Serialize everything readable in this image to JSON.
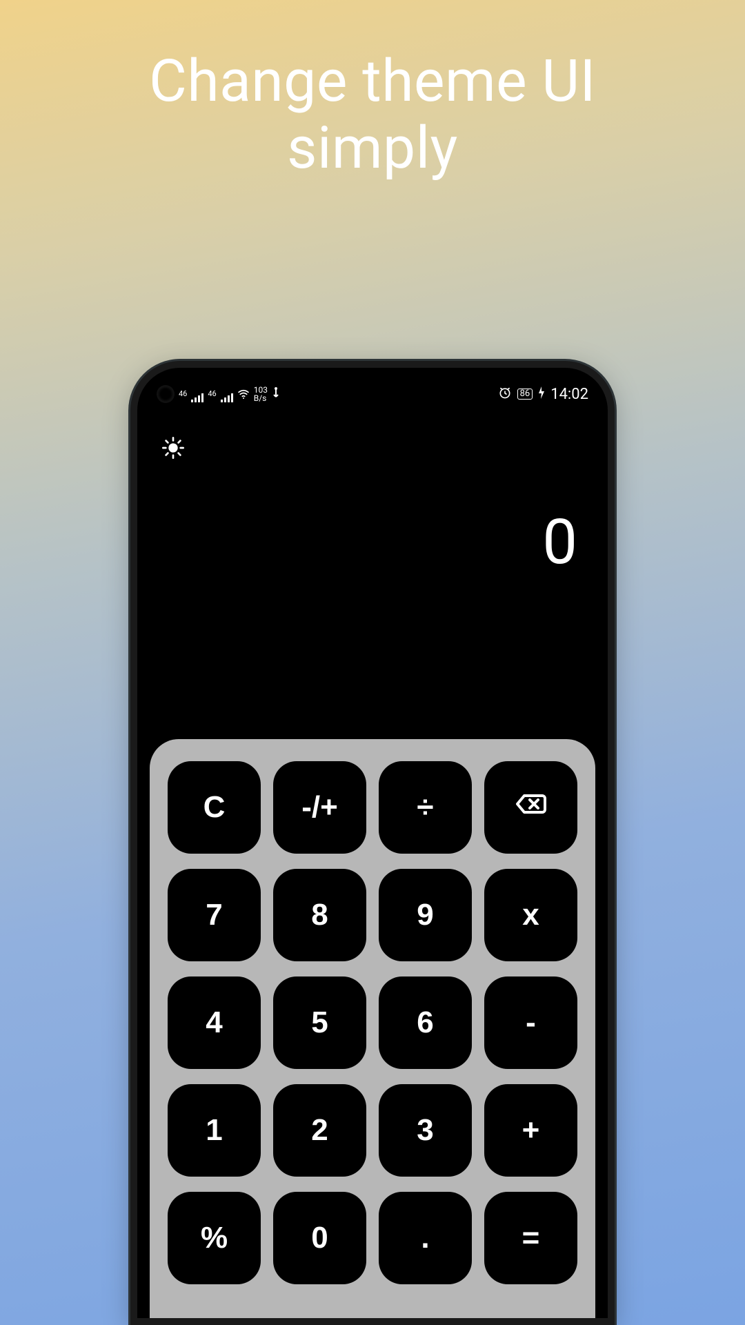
{
  "hero": {
    "line1": "Change theme UI",
    "line2": "simply"
  },
  "status_bar": {
    "network_label_1": "46",
    "network_label_2": "46",
    "speed_top": "103",
    "speed_bottom": "B/s",
    "battery_pct": "86",
    "time": "14:02"
  },
  "calculator": {
    "display": "0",
    "keys": {
      "clear": "C",
      "negate": "-/+",
      "divide": "÷",
      "seven": "7",
      "eight": "8",
      "nine": "9",
      "multiply": "x",
      "four": "4",
      "five": "5",
      "six": "6",
      "subtract": "-",
      "one": "1",
      "two": "2",
      "three": "3",
      "add": "+",
      "percent": "%",
      "zero": "0",
      "decimal": ".",
      "equals": "="
    }
  }
}
